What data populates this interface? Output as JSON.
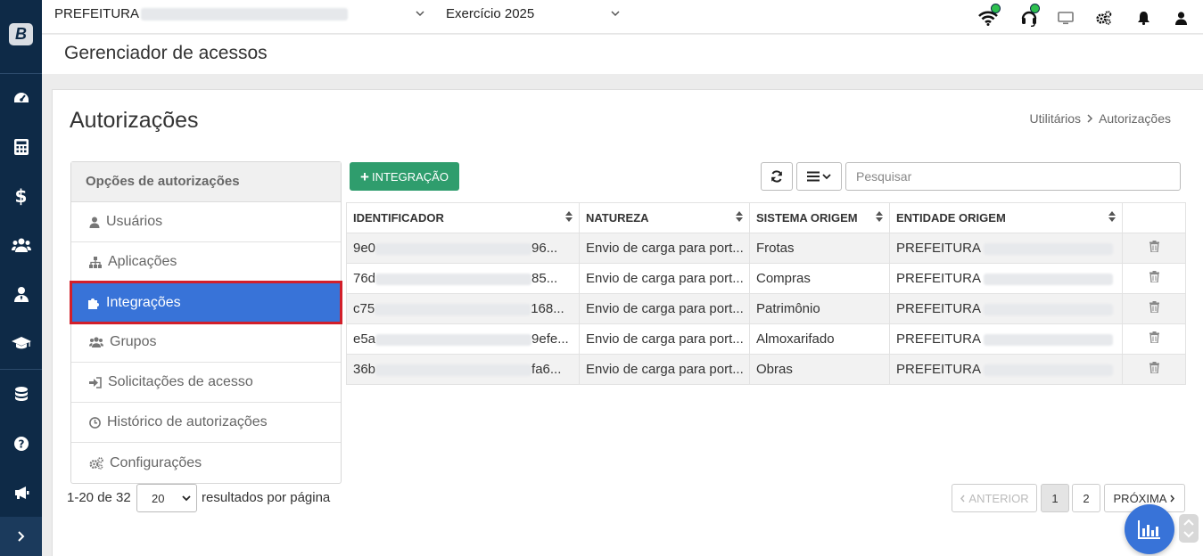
{
  "app": {
    "logo_letter": "B"
  },
  "rail": {
    "icons": [
      "dashboard-icon",
      "calculator-icon",
      "dollar-icon",
      "users-icon",
      "user-tie-icon",
      "graduation-cap-icon",
      "database-icon",
      "help-icon",
      "megaphone-icon"
    ],
    "expand_icon": "chevron-right-icon"
  },
  "topbar": {
    "org_prefix": "PREFEITURA",
    "exercise": "Exercício 2025",
    "icons": [
      "wifi-icon",
      "headset-icon",
      "monitor-icon",
      "cogs-icon",
      "bell-icon",
      "user-icon"
    ]
  },
  "page": {
    "title": "Gerenciador de acessos"
  },
  "content": {
    "heading": "Autorizações",
    "breadcrumb": [
      "Utilitários",
      "Autorizações"
    ]
  },
  "options": {
    "header": "Opções de autorizações",
    "items": [
      {
        "label": "Usuários",
        "icon": "user-icon"
      },
      {
        "label": "Aplicações",
        "icon": "sitemap-icon"
      },
      {
        "label": "Integrações",
        "icon": "puzzle-icon",
        "active": true
      },
      {
        "label": "Grupos",
        "icon": "users-icon"
      },
      {
        "label": "Solicitações de acesso",
        "icon": "sign-in-icon"
      },
      {
        "label": "Histórico de autorizações",
        "icon": "clock-icon"
      },
      {
        "label": "Configurações",
        "icon": "cogs-icon"
      }
    ]
  },
  "toolbar": {
    "add_label": "INTEGRAÇÃO",
    "search_placeholder": "Pesquisar"
  },
  "table": {
    "columns": [
      "IDENTIFICADOR",
      "NATUREZA",
      "SISTEMA ORIGEM",
      "ENTIDADE ORIGEM"
    ],
    "rows": [
      {
        "id_start": "9e0",
        "id_end": "96...",
        "natureza": "Envio de carga para port...",
        "sistema": "Frotas",
        "entidade": "PREFEITURA"
      },
      {
        "id_start": "76d",
        "id_end": "85...",
        "natureza": "Envio de carga para port...",
        "sistema": "Compras",
        "entidade": "PREFEITURA"
      },
      {
        "id_start": "c75",
        "id_end": "168...",
        "natureza": "Envio de carga para port...",
        "sistema": "Patrimônio",
        "entidade": "PREFEITURA"
      },
      {
        "id_start": "e5a",
        "id_end": "9efe...",
        "natureza": "Envio de carga para port...",
        "sistema": "Almoxarifado",
        "entidade": "PREFEITURA"
      },
      {
        "id_start": "36b",
        "id_end": "fa6...",
        "natureza": "Envio de carga para port...",
        "sistema": "Obras",
        "entidade": "PREFEITURA"
      }
    ]
  },
  "pagination": {
    "range": "1-20 de 32",
    "page_size": "20",
    "per_page_label": "resultados por página",
    "prev": "ANTERIOR",
    "pages": [
      "1",
      "2"
    ],
    "current": "1",
    "next": "PRÓXIMA"
  },
  "colors": {
    "rail": "#0e2a47",
    "accent": "#3873d8",
    "success": "#2f9d6d",
    "active_border": "#d21f2a",
    "status_dot": "#2ec04f"
  }
}
